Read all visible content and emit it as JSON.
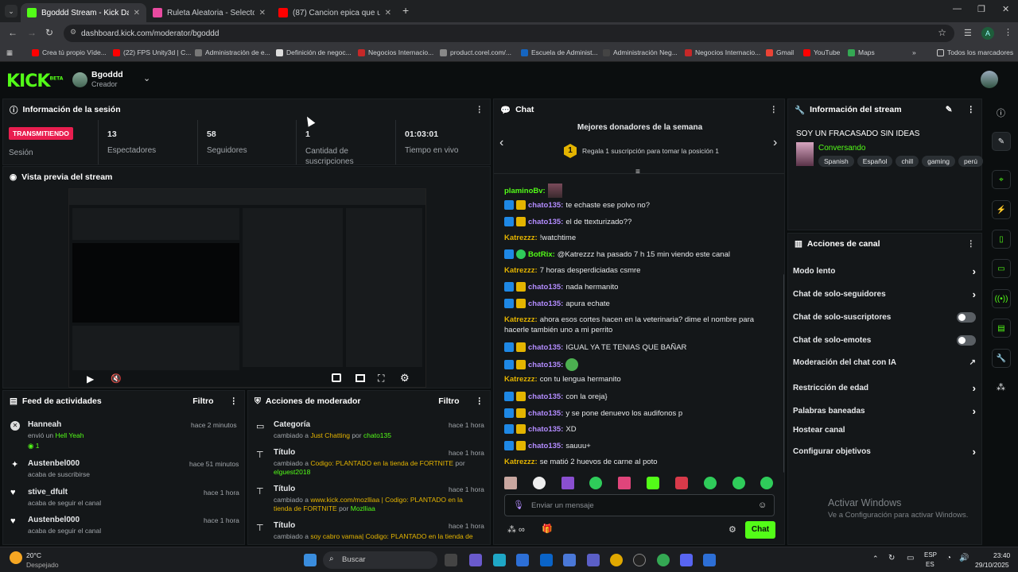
{
  "browser": {
    "tabs": [
      {
        "label": "Bgoddd Stream - Kick Dashboa",
        "color": "#53fc18"
      },
      {
        "label": "Ruleta Aleatoria - Selector Pers",
        "color": "#e84aa0"
      },
      {
        "label": "(87) Cancion epica que usa The",
        "color": "#ff0000"
      }
    ],
    "url": "dashboard.kick.com/moderator/bgoddd",
    "bookmarks": [
      {
        "label": "Crea tú propio Víde..."
      },
      {
        "label": "(22) FPS Unity3d | C..."
      },
      {
        "label": "Administración de e..."
      },
      {
        "label": "Definición de negoc..."
      },
      {
        "label": "Negocios Internacio..."
      },
      {
        "label": "product.corel.com/..."
      },
      {
        "label": "Escuela de Administ..."
      },
      {
        "label": "Administración Neg..."
      },
      {
        "label": "Negocios Internacio..."
      },
      {
        "label": "Gmail"
      },
      {
        "label": "YouTube"
      },
      {
        "label": "Maps"
      }
    ],
    "all_bookmarks": "Todos los marcadores",
    "profile_letter": "A"
  },
  "header": {
    "logo": "KICK",
    "logo_badge": "BETA",
    "channel": "Bgoddd",
    "role": "Creador"
  },
  "session": {
    "title": "Información de la sesión",
    "status": "TRANSMITIENDO",
    "status_label": "Sesión",
    "stats": [
      {
        "value": "13",
        "label": "Espectadores"
      },
      {
        "value": "58",
        "label": "Seguidores"
      },
      {
        "value": "1",
        "label": "Cantidad de suscripciones"
      },
      {
        "value": "01:03:01",
        "label": "Tiempo en vivo"
      }
    ]
  },
  "preview": {
    "title": "Vista previa del stream"
  },
  "feed": {
    "title": "Feed de actividades",
    "filter": "Filtro",
    "items": [
      {
        "name": "Hanneah",
        "time": "hace 2 minutos",
        "text": "envió un",
        "extra": "Hell Yeah",
        "count": "1"
      },
      {
        "name": "Austenbel000",
        "time": "hace 51 minutos",
        "text": "acaba de suscribirse",
        "extra": "",
        "count": ""
      },
      {
        "name": "stive_dfult",
        "time": "hace 1 hora",
        "text": "acaba de seguir el canal",
        "extra": "",
        "count": ""
      },
      {
        "name": "Austenbel000",
        "time": "hace 1 hora",
        "text": "acaba de seguir el canal",
        "extra": "",
        "count": ""
      }
    ]
  },
  "modactions": {
    "title": "Acciones de moderador",
    "filter": "Filtro",
    "items": [
      {
        "kind": "Categoría",
        "time": "hace 1 hora",
        "pre": "cambiado a",
        "value": "Just Chatting",
        "by": "por",
        "user": "chato135"
      },
      {
        "kind": "Título",
        "time": "hace 1 hora",
        "pre": "cambiado a",
        "value": "Codigo: PLANTADO en la tienda de FORTNITE",
        "by": "por",
        "user": "elguest2018"
      },
      {
        "kind": "Título",
        "time": "hace 1 hora",
        "pre": "cambiado a",
        "value": "www.kick.com/mozlliaa | Codigo: PLANTADO en la tienda de FORTNITE",
        "by": "por",
        "user": "Mozlliaa"
      },
      {
        "kind": "Título",
        "time": "hace 1 hora",
        "pre": "cambiado a",
        "value": "soy cabro vamaa| Codigo: PLANTADO en la tienda de",
        "by": "",
        "user": ""
      }
    ]
  },
  "chat": {
    "title": "Chat",
    "donors_title": "Mejores donadores de la semana",
    "donors_rank": "1",
    "donors_text": "Regala 1 suscripción para tomar la posición 1",
    "messages": [
      {
        "user": "plaminoBv:",
        "text": "",
        "badges": [],
        "color": "#53fc18"
      },
      {
        "user": "chato135:",
        "text": "te echaste ese polvo no?",
        "badges": [
          "b1",
          "b2"
        ],
        "color": "#b38cff"
      },
      {
        "user": "chato135:",
        "text": "el de ttexturizado??",
        "badges": [
          "b1",
          "b2"
        ],
        "color": "#b38cff"
      },
      {
        "user": "Katrezzz:",
        "text": "!watchtime",
        "badges": [],
        "color": "#e4b400"
      },
      {
        "user": "BotRix:",
        "text": "@Katrezzz ha pasado 7 h 15 min viendo este canal",
        "badges": [
          "b1",
          "b3"
        ],
        "color": "#53fc18"
      },
      {
        "user": "Katrezzz:",
        "text": "7 horas desperdiciadas csmre",
        "badges": [],
        "color": "#e4b400"
      },
      {
        "user": "chato135:",
        "text": "nada hermanito",
        "badges": [
          "b1",
          "b2"
        ],
        "color": "#b38cff"
      },
      {
        "user": "chato135:",
        "text": "apura echate",
        "badges": [
          "b1",
          "b2"
        ],
        "color": "#b38cff"
      },
      {
        "user": "Katrezzz:",
        "text": "ahora esos cortes hacen en la veterinaria? dime el nombre para",
        "badges": [],
        "color": "#e4b400"
      },
      {
        "user": "",
        "text": "hacerle también uno a mi perrito",
        "badges": [],
        "color": "#e4b400"
      },
      {
        "user": "chato135:",
        "text": "IGUAL YA TE TENIAS QUE BAÑAR",
        "badges": [
          "b1",
          "b2"
        ],
        "color": "#b38cff"
      },
      {
        "user": "chato135:",
        "text": "",
        "badges": [
          "b1",
          "b2"
        ],
        "color": "#b38cff"
      },
      {
        "user": "Katrezzz:",
        "text": "con tu lengua hermanito",
        "badges": [],
        "color": "#e4b400"
      },
      {
        "user": "chato135:",
        "text": "con la oreja}",
        "badges": [
          "b1",
          "b2"
        ],
        "color": "#b38cff"
      },
      {
        "user": "chato135:",
        "text": "y se pone denuevo los audifonos p",
        "badges": [
          "b1",
          "b2"
        ],
        "color": "#b38cff"
      },
      {
        "user": "chato135:",
        "text": "XD",
        "badges": [
          "b1",
          "b2"
        ],
        "color": "#b38cff"
      },
      {
        "user": "chato135:",
        "text": "sauuu+",
        "badges": [
          "b1",
          "b2"
        ],
        "color": "#b38cff"
      },
      {
        "user": "Katrezzz:",
        "text": "se matió 2 huevos de carne al poto",
        "badges": [],
        "color": "#e4b400"
      }
    ],
    "input_placeholder": "Enviar un mensaje",
    "send": "Chat"
  },
  "stream_info": {
    "title": "Información del stream",
    "stream_title": "SOY UN FRACASADO SIN IDEAS",
    "category": "Conversando",
    "tags": [
      "Spanish",
      "Español",
      "chill",
      "gaming",
      "perú"
    ]
  },
  "channel_actions": {
    "title": "Acciones de canal",
    "items": [
      {
        "label": "Modo lento",
        "control": "chevron"
      },
      {
        "label": "Chat de solo-seguidores",
        "control": "chevron"
      },
      {
        "label": "Chat de solo-suscriptores",
        "control": "toggle"
      },
      {
        "label": "Chat de solo-emotes",
        "control": "toggle"
      },
      {
        "label": "Moderación del chat con IA",
        "control": "external"
      },
      {
        "label": "Restricción de edad",
        "control": "chevron"
      },
      {
        "label": "Palabras baneadas",
        "control": "chevron"
      },
      {
        "label": "Hostear canal",
        "control": "none"
      },
      {
        "label": "Configurar objetivos",
        "control": "chevron"
      }
    ]
  },
  "watermark": {
    "line1": "Activar Windows",
    "line2": "Ve a Configuración para activar Windows."
  },
  "taskbar": {
    "weather_temp": "20°C",
    "weather_desc": "Despejado",
    "search": "Buscar",
    "lang1": "ESP",
    "lang2": "ES",
    "time": "23:40",
    "date": "29/10/2025"
  },
  "colors": {
    "accent": "#53fc18",
    "live": "#e91e4f"
  }
}
